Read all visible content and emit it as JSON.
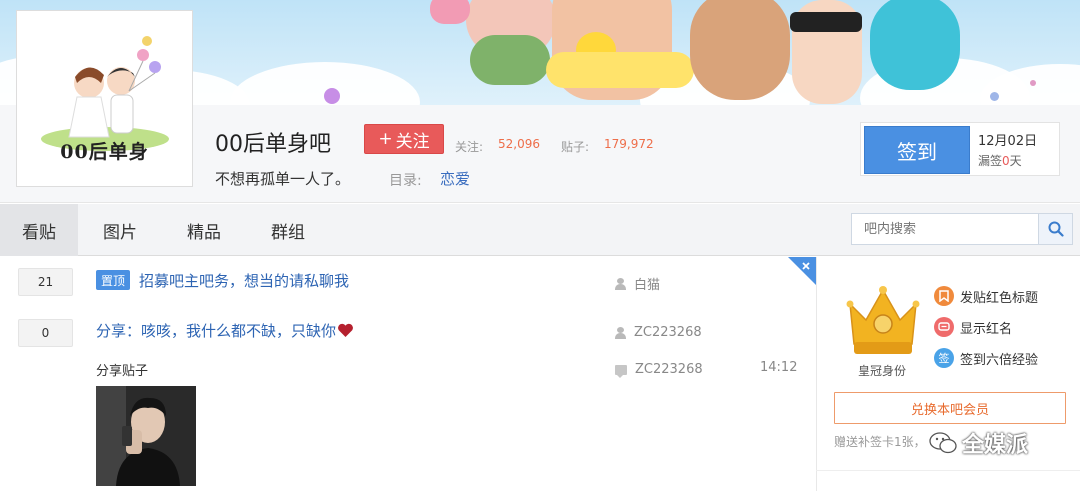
{
  "forum": {
    "name": "00后单身吧",
    "avatar_text": "00后单身",
    "slogan": "不想再孤单一人了。",
    "follow_label": "关注",
    "stats": {
      "followers_label": "关注:",
      "followers_value": "52,096",
      "posts_label": "贴子:",
      "posts_value": "179,972"
    },
    "category_label": "目录:",
    "category_value": "恋爱"
  },
  "signin": {
    "button_label": "签到",
    "date": "12月02日",
    "missed_prefix": "漏签",
    "missed_count": "0",
    "missed_suffix": "天"
  },
  "nav": {
    "tabs": [
      {
        "label": "看贴",
        "active": true
      },
      {
        "label": "图片",
        "active": false
      },
      {
        "label": "精品",
        "active": false
      },
      {
        "label": "群组",
        "active": false
      }
    ],
    "search_placeholder": "吧内搜索"
  },
  "threads": [
    {
      "reply_count": "21",
      "badge": "置顶",
      "title": "招募吧主吧务，想当的请私聊我",
      "author": "白猫"
    },
    {
      "reply_count": "0",
      "title": "分享：咳咳，我什么都不缺，只缺你",
      "author": "ZC223268",
      "excerpt": "分享贴子",
      "last_reply_author": "ZC223268",
      "time": "14:12"
    }
  ],
  "sidebar": {
    "crown_label": "皇冠身份",
    "perks": [
      {
        "label": "发贴红色标题",
        "icon": "bookmark-icon",
        "color": "#f08a3c"
      },
      {
        "label": "显示红名",
        "icon": "chat-icon",
        "color": "#ef6b6b"
      },
      {
        "label": "签到六倍经验",
        "icon": "sign-icon",
        "color": "#4aa3e8"
      }
    ],
    "perk_icon_text": "签",
    "redeem_label": "兑换本吧会员",
    "gift_text": "赠送补签卡1张，"
  },
  "watermark": "全媒派",
  "colors": {
    "accent_blue": "#4a90e2",
    "follow_red": "#e85a5a",
    "link_blue": "#2d64b3",
    "stat_orange": "#ee6e4a"
  }
}
